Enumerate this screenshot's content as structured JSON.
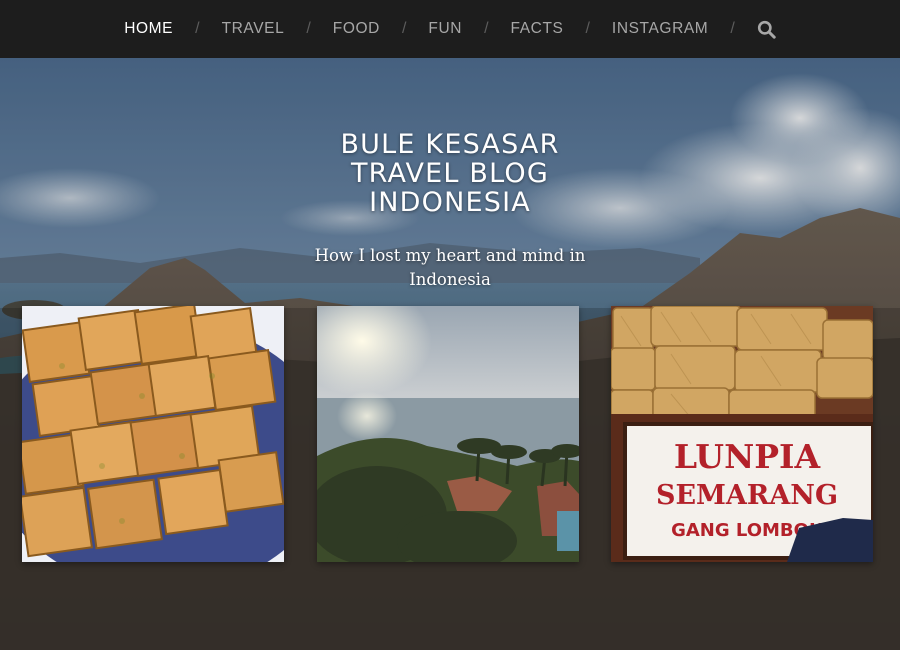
{
  "nav": {
    "items": [
      {
        "label": "HOME",
        "active": true
      },
      {
        "label": "TRAVEL",
        "active": false
      },
      {
        "label": "FOOD",
        "active": false
      },
      {
        "label": "FUN",
        "active": false
      },
      {
        "label": "FACTS",
        "active": false
      },
      {
        "label": "INSTAGRAM",
        "active": false
      }
    ],
    "search_icon": "search-icon"
  },
  "hero": {
    "title_lines": [
      "BULE KESASAR",
      "TRAVEL BLOG",
      "INDONESIA"
    ],
    "tagline": "How I lost my heart and mind in Indonesia"
  },
  "posts": [
    {
      "image": "martabak-food-photo"
    },
    {
      "image": "sunset-sea-view-photo"
    },
    {
      "image": "lunpia-semarang-sign-photo",
      "sign_lines": [
        "LUNPIA",
        "SEMARANG",
        "GANG LOMBOK"
      ]
    }
  ],
  "colors": {
    "nav_bg": "#1d1d1d",
    "nav_text": "#a7a7a7",
    "nav_active": "#ffffff",
    "sign_red": "#b3212a"
  }
}
